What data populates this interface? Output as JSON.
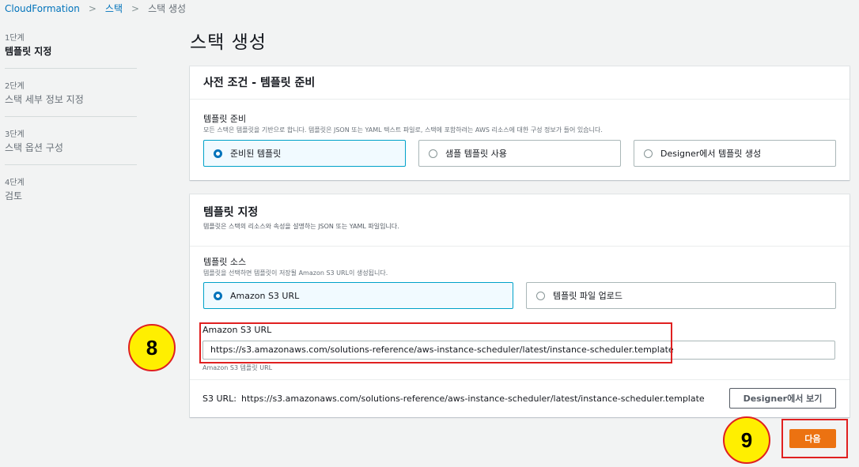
{
  "breadcrumb": {
    "root": "CloudFormation",
    "mid": "스택",
    "current": "스택 생성",
    "sep": ">"
  },
  "steps": [
    {
      "num": "1단계",
      "title": "템플릿 지정",
      "active": true
    },
    {
      "num": "2단계",
      "title": "스택 세부 정보 지정"
    },
    {
      "num": "3단계",
      "title": "스택 옵션 구성"
    },
    {
      "num": "4단계",
      "title": "검토"
    }
  ],
  "page_title": "스택 생성",
  "prereq": {
    "title": "사전 조건 - 템플릿 준비",
    "label": "템플릿 준비",
    "desc": "모든 스택은 템플릿을 기반으로 합니다. 템플릿은 JSON 또는 YAML 텍스트 파일로, 스택에 포함하려는 AWS 리소스에 대한 구성 정보가 들어 있습니다.",
    "options": [
      "준비된 템플릿",
      "샘플 템플릿 사용",
      "Designer에서 템플릿 생성"
    ],
    "selected": 0
  },
  "specify": {
    "title": "템플릿 지정",
    "desc": "템플릿은 스택의 리소스와 속성을 설명하는 JSON 또는 YAML 파일입니다.",
    "source_label": "템플릿 소스",
    "source_desc": "템플릿을 선택하면 템플릿이 저장될 Amazon S3 URL이 생성됩니다.",
    "source_options": [
      "Amazon S3 URL",
      "템플릿 파일 업로드"
    ],
    "url_label": "Amazon S3 URL",
    "url_value": "https://s3.amazonaws.com/solutions-reference/aws-instance-scheduler/latest/instance-scheduler.template",
    "url_hint": "Amazon S3 템플릿 URL",
    "footer_key": "S3 URL:",
    "footer_value": "https://s3.amazonaws.com/solutions-reference/aws-instance-scheduler/latest/instance-scheduler.template",
    "designer_button": "Designer에서 보기"
  },
  "next_button": "다음",
  "callouts": [
    "8",
    "9"
  ],
  "colors": {
    "accent": "#0073bb",
    "primary_button": "#ec7211",
    "highlight": "#e02020",
    "callout_fill": "#ffef00"
  }
}
